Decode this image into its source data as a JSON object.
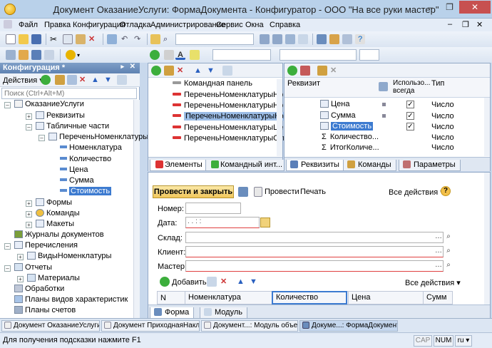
{
  "window": {
    "title": "Документ ОказаниеУслуги: ФормаДокумента - Конфигуратор - ООО \"На все руки мастер\"",
    "minimize": "–",
    "restore": "❐",
    "close": "✕"
  },
  "menu": {
    "file": "Файл",
    "edit": "Правка",
    "config": "Конфигурация",
    "debug": "Отладка",
    "admin": "Администрирование",
    "service": "Сервис",
    "windows": "Окна",
    "help": "Справка"
  },
  "config_panel": {
    "title": "Конфигурация *",
    "actions": "Действия ▾",
    "search_placeholder": "Поиск (Ctrl+Alt+M)",
    "tree": [
      {
        "label": "ОказаниеУслуги"
      },
      {
        "label": "Реквизиты"
      },
      {
        "label": "Табличные части"
      },
      {
        "label": "ПереченьНоменклатуры"
      },
      {
        "label": "Номенклатура"
      },
      {
        "label": "Количество"
      },
      {
        "label": "Цена"
      },
      {
        "label": "Сумма"
      },
      {
        "label": "Стоимость"
      },
      {
        "label": "Формы"
      },
      {
        "label": "Команды"
      },
      {
        "label": "Макеты"
      },
      {
        "label": "Журналы документов"
      },
      {
        "label": "Перечисления"
      },
      {
        "label": "ВидыНоменклатуры"
      },
      {
        "label": "Отчеты"
      },
      {
        "label": "Материалы"
      },
      {
        "label": "Обработки"
      },
      {
        "label": "Планы видов характеристик"
      },
      {
        "label": "Планы счетов"
      }
    ]
  },
  "elements_panel": {
    "items": [
      {
        "label": "Командная панель"
      },
      {
        "label": "ПереченьНоменклатурыНоме"
      },
      {
        "label": "ПереченьНоменклатурыНоме"
      },
      {
        "label": "ПереченьНоменклатурыКоли"
      },
      {
        "label": "ПереченьНоменклатурыЦена"
      },
      {
        "label": "ПереченьНоменклатурыСумм"
      }
    ],
    "tab_elements": "Элементы",
    "tab_cmd": "Командный инт..."
  },
  "requisites_panel": {
    "col_req": "Реквизит",
    "col_use": "Использо... всегда",
    "col_type": "Тип",
    "rows": [
      {
        "name": "Цена",
        "type": "Число"
      },
      {
        "name": "Сумма",
        "type": "Число"
      },
      {
        "name": "Стоимость",
        "type": "Число"
      },
      {
        "name": "Количество...",
        "type": "Число"
      },
      {
        "name": "ИтогКоличе...",
        "type": "Число"
      }
    ],
    "tab_req": "Реквизиты",
    "tab_cmd": "Команды",
    "tab_params": "Параметры"
  },
  "form_preview": {
    "post_close": "Провести и закрыть",
    "post": "Провести",
    "print": "Печать",
    "all_actions": "Все действия ▾",
    "help": "?",
    "number_label": "Номер:",
    "date_label": "Дата:",
    "date_value": " .  .       :  :",
    "warehouse_label": "Склад:",
    "client_label": "Клиент:",
    "master_label": "Мастер:",
    "add": "Добавить",
    "all_actions2": "Все действия ▾",
    "columns": [
      "N",
      "Номенклатура",
      "Количество",
      "Цена",
      "Сумм"
    ],
    "tab_form": "Форма",
    "tab_module": "Модуль"
  },
  "taskbar": {
    "items": [
      {
        "label": "Документ ОказаниеУслуги"
      },
      {
        "label": "Документ ПриходнаяНакла..."
      },
      {
        "label": "Документ...: Модуль объекта"
      },
      {
        "label": "Докуме...: ФормаДокумента"
      }
    ]
  },
  "status": {
    "hint": "Для получения подсказки нажмите F1",
    "cap": "CAP",
    "num": "NUM",
    "lang": "ru ▾"
  },
  "colors": {
    "accent": "#3d7bd0",
    "panel_header": "#6a8dbd",
    "required_field": "#e04040"
  }
}
